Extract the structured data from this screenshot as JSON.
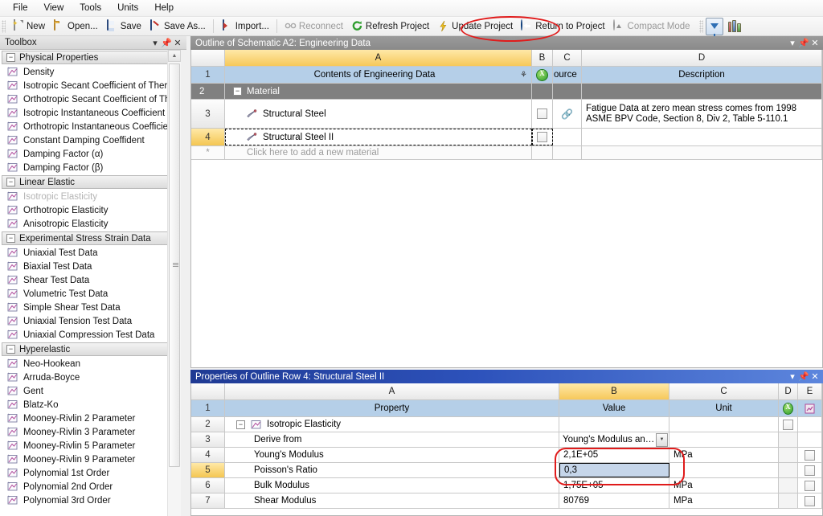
{
  "menu": {
    "items": [
      "File",
      "View",
      "Tools",
      "Units",
      "Help"
    ]
  },
  "toolbar": {
    "buttons": [
      {
        "label": "New",
        "icon": "new-document-icon",
        "disabled": false
      },
      {
        "label": "Open...",
        "icon": "open-folder-icon",
        "disabled": false
      },
      {
        "label": "Save",
        "icon": "save-disk-icon",
        "disabled": false
      },
      {
        "label": "Save As...",
        "icon": "save-as-icon",
        "disabled": false
      },
      {
        "label": "Import...",
        "icon": "import-icon",
        "disabled": false
      },
      {
        "label": "Reconnect",
        "icon": "reconnect-icon",
        "disabled": true
      },
      {
        "label": "Refresh Project",
        "icon": "refresh-icon",
        "disabled": false
      },
      {
        "label": "Update Project",
        "icon": "update-lightning-icon",
        "disabled": false
      },
      {
        "label": "Return to Project",
        "icon": "return-arrow-icon",
        "disabled": false
      },
      {
        "label": "Compact Mode",
        "icon": "compact-mode-icon",
        "disabled": true
      }
    ],
    "right_icons": [
      {
        "name": "filter-funnel-icon",
        "pressed": true
      },
      {
        "name": "engineering-data-books-icon",
        "pressed": false
      }
    ]
  },
  "toolbox": {
    "title": "Toolbox",
    "caption_buttons": [
      "menu-chevron-icon",
      "pin-icon",
      "close-icon"
    ],
    "groups": [
      {
        "name": "Physical Properties",
        "expanded": true,
        "items": [
          {
            "label": "Density",
            "dim": false
          },
          {
            "label": "Isotropic Secant Coefficient of Thermal",
            "dim": false
          },
          {
            "label": "Orthotropic Secant Coefficient of Therm",
            "dim": false
          },
          {
            "label": "Isotropic Instantaneous Coefficient of",
            "dim": false
          },
          {
            "label": "Orthotropic Instantaneous Coefficient",
            "dim": false
          },
          {
            "label": "Constant Damping Coeffident",
            "dim": false
          },
          {
            "label": "Damping Factor (α)",
            "dim": false
          },
          {
            "label": "Damping Factor (β)",
            "dim": false
          }
        ]
      },
      {
        "name": "Linear Elastic",
        "expanded": true,
        "items": [
          {
            "label": "Isotropic Elasticity",
            "dim": true
          },
          {
            "label": "Orthotropic Elasticity",
            "dim": false
          },
          {
            "label": "Anisotropic Elasticity",
            "dim": false
          }
        ]
      },
      {
        "name": "Experimental Stress Strain Data",
        "expanded": true,
        "items": [
          {
            "label": "Uniaxial Test Data",
            "dim": false
          },
          {
            "label": "Biaxial Test Data",
            "dim": false
          },
          {
            "label": "Shear Test Data",
            "dim": false
          },
          {
            "label": "Volumetric Test Data",
            "dim": false
          },
          {
            "label": "Simple Shear Test Data",
            "dim": false
          },
          {
            "label": "Uniaxial Tension Test Data",
            "dim": false
          },
          {
            "label": "Uniaxial Compression Test Data",
            "dim": false
          }
        ]
      },
      {
        "name": "Hyperelastic",
        "expanded": true,
        "items": [
          {
            "label": "Neo-Hookean",
            "dim": false
          },
          {
            "label": "Arruda-Boyce",
            "dim": false
          },
          {
            "label": "Gent",
            "dim": false
          },
          {
            "label": "Blatz-Ko",
            "dim": false
          },
          {
            "label": "Mooney-Rivlin 2 Parameter",
            "dim": false
          },
          {
            "label": "Mooney-Rivlin 3 Parameter",
            "dim": false
          },
          {
            "label": "Mooney-Rivlin 5 Parameter",
            "dim": false
          },
          {
            "label": "Mooney-Rivlin 9 Parameter",
            "dim": false
          },
          {
            "label": "Polynomial 1st Order",
            "dim": false
          },
          {
            "label": "Polynomial 2nd Order",
            "dim": false
          },
          {
            "label": "Polynomial 3rd Order",
            "dim": false
          }
        ]
      }
    ]
  },
  "outline": {
    "title": "Outline of Schematic A2: Engineering Data",
    "active": false,
    "caption_buttons": [
      "menu-chevron-icon",
      "pin-icon",
      "close-icon"
    ],
    "columns": [
      "A",
      "B",
      "C",
      "D"
    ],
    "selected_column": "A",
    "header_row": {
      "num": "1",
      "a": "Contents of Engineering Data",
      "b_icon": "excel-source-icon",
      "c": "ource",
      "d": "Description"
    },
    "rows": [
      {
        "num": "2",
        "type": "group",
        "label": "Material"
      },
      {
        "num": "3",
        "type": "material",
        "label": "Structural Steel",
        "checkbox": true,
        "link_icon": true,
        "description": "Fatigue Data at zero mean stress comes from 1998 ASME BPV Code, Section 8, Div 2, Table 5-110.1"
      },
      {
        "num": "4",
        "type": "material",
        "label": "Structural Steel II",
        "checkbox": true,
        "link_icon": false,
        "description": "",
        "selected": true
      },
      {
        "num": "*",
        "type": "add",
        "label": "Click here to add a new material"
      }
    ]
  },
  "properties": {
    "title": "Properties of Outline Row 4: Structural Steel II",
    "active": true,
    "caption_buttons": [
      "menu-chevron-icon",
      "pin-icon",
      "close-icon"
    ],
    "columns": [
      "A",
      "B",
      "C",
      "D",
      "E"
    ],
    "selected_column": "B",
    "header_row": {
      "num": "1",
      "a": "Property",
      "b": "Value",
      "c": "Unit",
      "d_icon": "excel-source-icon",
      "e_icon": "chart-link-icon"
    },
    "rows": [
      {
        "num": "2",
        "property": "Isotropic Elasticity",
        "value": "",
        "unit": "",
        "group": true,
        "d_check": true,
        "e_check": false
      },
      {
        "num": "3",
        "property": "Derive from",
        "value": "Young's Modulus and...",
        "unit": "",
        "combo": true,
        "d_check": false,
        "e_check": false
      },
      {
        "num": "4",
        "property": "Young's Modulus",
        "value": "2,1E+05",
        "unit": "MPa",
        "d_check": false,
        "e_check": true
      },
      {
        "num": "5",
        "property": "Poisson's Ratio",
        "value": "0,3",
        "unit": "",
        "editing": true,
        "selected": true,
        "d_check": false,
        "e_check": true
      },
      {
        "num": "6",
        "property": "Bulk Modulus",
        "value": "1,75E+05",
        "unit": "MPa",
        "d_check": false,
        "e_check": true
      },
      {
        "num": "7",
        "property": "Shear Modulus",
        "value": "80769",
        "unit": "MPa",
        "d_check": false,
        "e_check": true
      }
    ]
  },
  "annotations": {
    "accent_color": "#e01b1b",
    "shapes": [
      {
        "name": "return-to-project-highlight",
        "type": "ellipse"
      },
      {
        "name": "modulus-values-highlight",
        "type": "rounded-rect"
      }
    ]
  }
}
